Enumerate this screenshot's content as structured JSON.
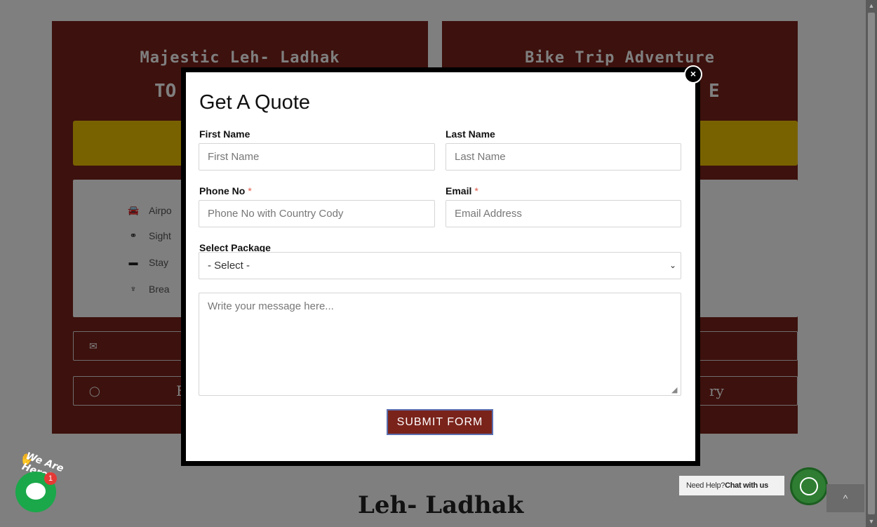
{
  "background": {
    "left_card": {
      "title": "Majestic Leh- Ladhak",
      "subtitle": "TO",
      "inclusions": [
        "Airpo",
        "Sight",
        "Stay",
        "Brea"
      ],
      "email_btn": "",
      "whatsapp_btn": "E"
    },
    "right_card": {
      "title": "Bike Trip Adventure",
      "subtitle": "E",
      "whatsapp_btn": "ry"
    },
    "bottom_title": "Leh- Ladhak"
  },
  "modal": {
    "title": "Get A Quote",
    "close_glyph": "×",
    "first_name": {
      "label": "First Name",
      "placeholder": "First Name",
      "value": ""
    },
    "last_name": {
      "label": "Last Name",
      "placeholder": "Last Name",
      "value": ""
    },
    "phone": {
      "label": "Phone No",
      "required_mark": "*",
      "placeholder": "Phone No with Country Cody",
      "value": ""
    },
    "email": {
      "label": "Email",
      "required_mark": "*",
      "placeholder": "Email Address",
      "value": ""
    },
    "package": {
      "label": "Select Package",
      "selected": "- Select -"
    },
    "message": {
      "placeholder": "Write your message here...",
      "value": ""
    },
    "submit_label": "SUBMIT FORM"
  },
  "widgets": {
    "we_are_here": "We Are Here!",
    "chat_badge_count": "1",
    "help_text_prefix": "Need Help?",
    "help_text_bold": "Chat with us",
    "back_to_top_glyph": "^"
  },
  "colors": {
    "brand_maroon": "#7a231b",
    "accent_yellow": "#f0c400",
    "whatsapp_green": "#2e7d32",
    "chat_green": "#1aa84a",
    "required_red": "#e05a4a"
  },
  "icons": {
    "close": "close-icon",
    "chevron": "chevron-down-icon",
    "car": "car-icon",
    "binoculars": "binoculars-icon",
    "bed": "bed-icon",
    "utensils": "utensils-icon",
    "envelope": "envelope-icon",
    "whatsapp": "whatsapp-icon"
  }
}
